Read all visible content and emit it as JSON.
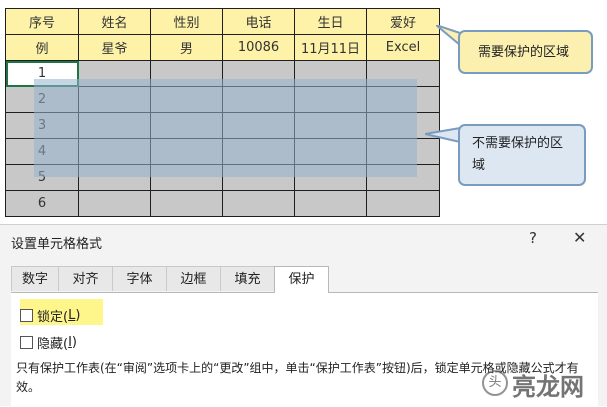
{
  "sheet": {
    "headers": [
      "序号",
      "姓名",
      "性别",
      "电话",
      "生日",
      "爱好"
    ],
    "example": [
      "例",
      "星爷",
      "男",
      "10086",
      "11月11日",
      "Excel"
    ],
    "row_numbers": [
      "1",
      "2",
      "3",
      "4",
      "5",
      "6"
    ]
  },
  "callouts": {
    "protected": "需要保护的区域",
    "unprotected": "不需要保护的区域"
  },
  "dialog": {
    "title": "设置单元格格式",
    "help_glyph": "?",
    "close_glyph": "✕",
    "tabs": [
      "数字",
      "对齐",
      "字体",
      "边框",
      "填充",
      "保护"
    ],
    "active_tab": "保护",
    "locked_label": "锁定(",
    "locked_key": "L",
    "locked_end": ")",
    "hidden_label": "隐藏(",
    "hidden_key": "I",
    "hidden_end": ")",
    "description": "只有保护工作表(在“审阅”选项卡上的“更改”组中，单击“保护工作表”按钮)后，锁定单元格或隐藏公式才有效。"
  },
  "watermark": {
    "text": "亮龙网",
    "logo_text": "头"
  }
}
